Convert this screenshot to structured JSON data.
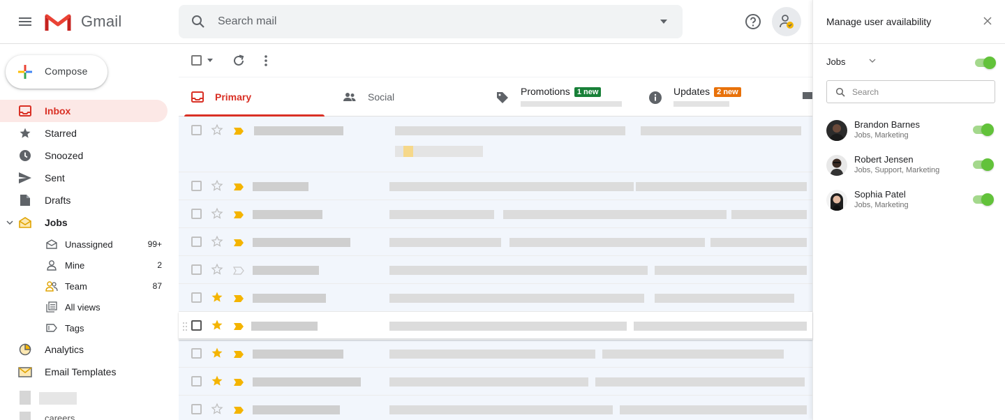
{
  "header": {
    "app_name": "Gmail",
    "search_placeholder": "Search mail"
  },
  "sidebar": {
    "compose_label": "Compose",
    "items": [
      {
        "label": "Inbox",
        "icon": "inbox-icon",
        "active": true
      },
      {
        "label": "Starred",
        "icon": "star-icon"
      },
      {
        "label": "Snoozed",
        "icon": "clock-icon"
      },
      {
        "label": "Sent",
        "icon": "send-icon"
      },
      {
        "label": "Drafts",
        "icon": "draft-icon"
      }
    ],
    "jobs_label": "Jobs",
    "jobs_children": [
      {
        "label": "Unassigned",
        "count": "99+",
        "icon": "envelope-open-icon"
      },
      {
        "label": "Mine",
        "count": "2",
        "icon": "person-icon"
      },
      {
        "label": "Team",
        "count": "87",
        "icon": "team-icon"
      },
      {
        "label": "All views",
        "count": "",
        "icon": "views-icon"
      },
      {
        "label": "Tags",
        "count": "",
        "icon": "tag-icon"
      }
    ],
    "analytics_label": "Analytics",
    "templates_label": "Email Templates",
    "careers_label": "careers"
  },
  "tabs": [
    {
      "label": "Primary",
      "badge": ""
    },
    {
      "label": "Social",
      "badge": ""
    },
    {
      "label": "Promotions",
      "badge": "1 new"
    },
    {
      "label": "Updates",
      "badge": "2 new"
    }
  ],
  "colors": {
    "accent_red": "#d93025",
    "promotions_badge": "#188038",
    "updates_badge": "#e8710a",
    "toggle_on": "#62c23a",
    "star_yellow": "#f4b400"
  },
  "email_rows": [
    {
      "starred": false,
      "important": true
    },
    {
      "starred": false,
      "important": true
    },
    {
      "starred": false,
      "important": true
    },
    {
      "starred": false,
      "important": true
    },
    {
      "starred": false,
      "important": false
    },
    {
      "starred": true,
      "important": true
    },
    {
      "starred": true,
      "important": true
    },
    {
      "starred": true,
      "important": true
    },
    {
      "starred": true,
      "important": true
    },
    {
      "starred": false,
      "important": true
    }
  ],
  "panel": {
    "title": "Manage user availability",
    "group_label": "Jobs",
    "group_enabled": true,
    "search_placeholder": "Search",
    "users": [
      {
        "name": "Brandon Barnes",
        "roles": "Jobs, Marketing",
        "available": true
      },
      {
        "name": "Robert Jensen",
        "roles": "Jobs, Support, Marketing",
        "available": true
      },
      {
        "name": "Sophia Patel",
        "roles": "Jobs, Marketing",
        "available": true
      }
    ]
  }
}
